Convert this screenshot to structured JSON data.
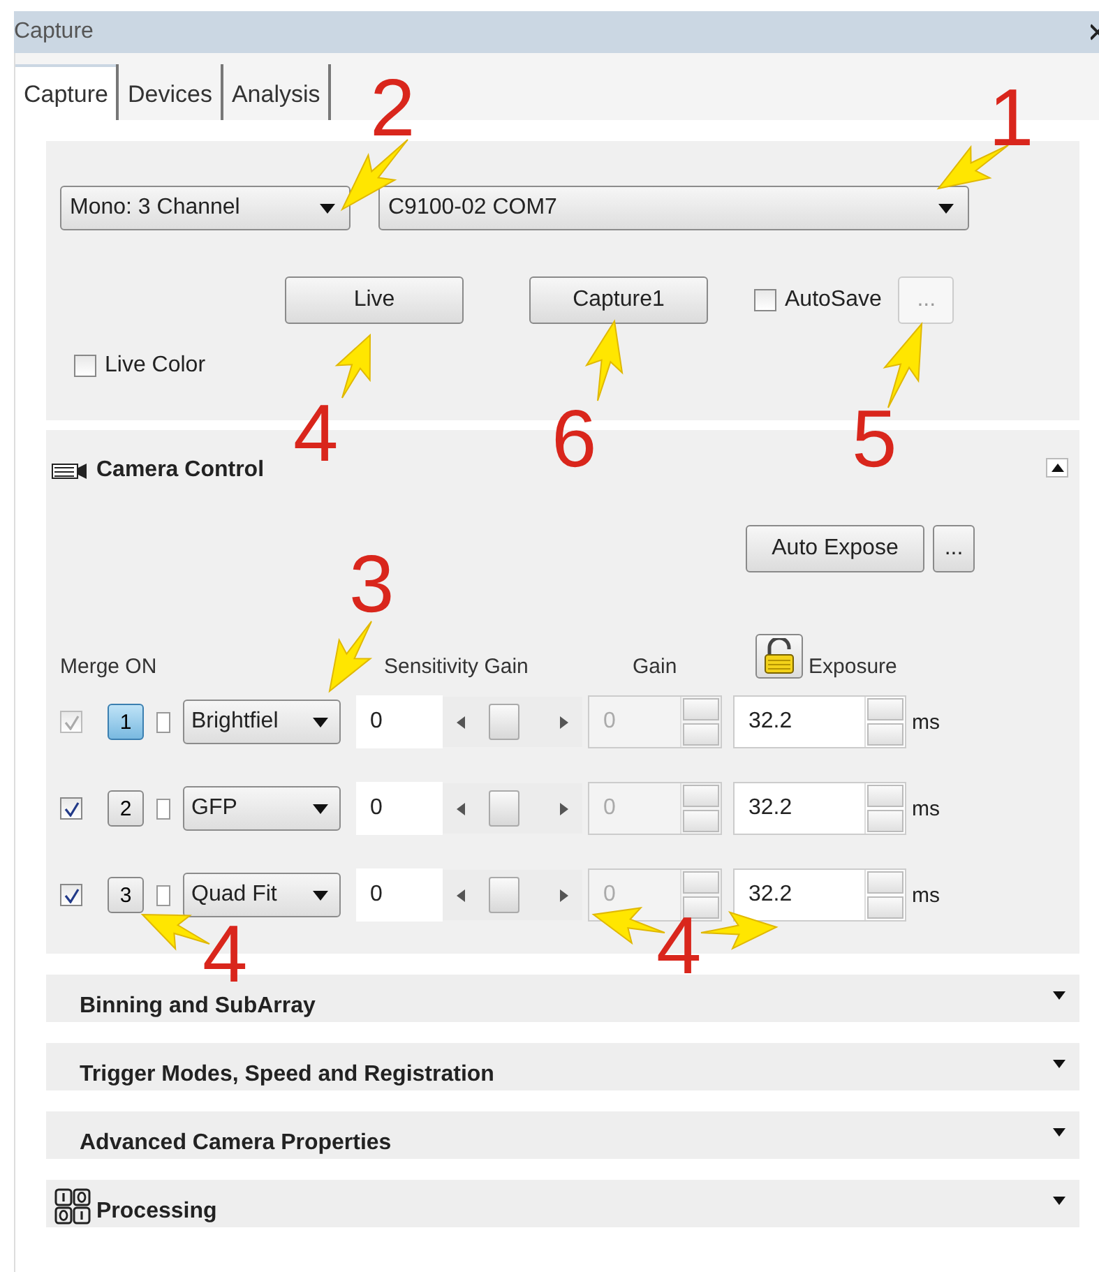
{
  "window": {
    "title": "Capture"
  },
  "tabs": [
    {
      "label": "Capture",
      "selected": true
    },
    {
      "label": "Devices",
      "selected": false
    },
    {
      "label": "Analysis",
      "selected": false
    }
  ],
  "acquisition": {
    "mode_select": {
      "value": "Mono: 3 Channel"
    },
    "camera_select": {
      "value": "C9100-02 COM7"
    },
    "live_button": "Live",
    "capture_button": "Capture1",
    "autosave": {
      "label": "AutoSave",
      "checked": false
    },
    "autosave_options": "...",
    "live_color": {
      "label": "Live Color",
      "checked": false
    }
  },
  "camera_control": {
    "title": "Camera Control",
    "expanded": true,
    "auto_expose_button": "Auto Expose",
    "options_button": "...",
    "headers": {
      "merge": "Merge ON",
      "sensitivity": "Sensitivity Gain",
      "gain": "Gain",
      "exposure": "Exposure"
    },
    "channels": [
      {
        "merge": true,
        "merge_disabled": true,
        "number": "1",
        "selected": true,
        "solo": false,
        "filter": "Brightfiel",
        "sensitivity": "0",
        "level": 0.4,
        "gain": "0",
        "exposure": "32.2",
        "unit": "ms"
      },
      {
        "merge": true,
        "merge_disabled": false,
        "number": "2",
        "selected": false,
        "solo": false,
        "filter": "GFP",
        "sensitivity": "0",
        "level": 0.4,
        "gain": "0",
        "exposure": "32.2",
        "unit": "ms"
      },
      {
        "merge": true,
        "merge_disabled": false,
        "number": "3",
        "selected": false,
        "solo": false,
        "filter": "Quad Fit",
        "sensitivity": "0",
        "level": 0.4,
        "gain": "0",
        "exposure": "32.2",
        "unit": "ms"
      }
    ]
  },
  "sections": [
    {
      "title": "Binning and SubArray",
      "kind": "plain",
      "expanded": false
    },
    {
      "title": "Trigger Modes, Speed and Registration",
      "kind": "plain",
      "expanded": false
    },
    {
      "title": "Advanced Camera Properties",
      "kind": "plain",
      "expanded": false
    },
    {
      "title": "Processing",
      "kind": "processing",
      "expanded": false
    }
  ],
  "callouts": [
    {
      "label": "2"
    },
    {
      "label": "1"
    },
    {
      "label": "4"
    },
    {
      "label": "6"
    },
    {
      "label": "5"
    },
    {
      "label": "3"
    },
    {
      "label": "4"
    },
    {
      "label": "4"
    }
  ]
}
